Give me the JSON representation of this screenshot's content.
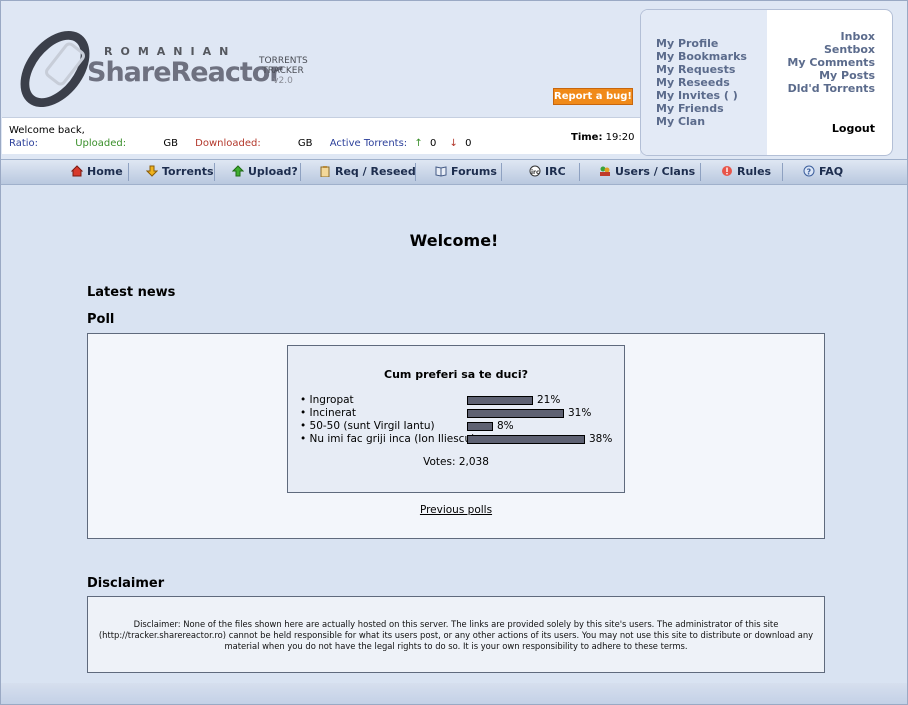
{
  "logo": {
    "top": "ROMANIAN",
    "name": "ShareReactor",
    "tracker_lines": [
      "TORRENTS",
      "TRACKER",
      "v2.0"
    ]
  },
  "report_bug": "Report a bug!",
  "user_menu": {
    "left": [
      "My Profile",
      "My Bookmarks",
      "My Requests",
      "My Reseeds",
      "My Invites (  )",
      "My Friends",
      "My Clan"
    ],
    "right": [
      "Inbox",
      "Sentbox",
      "My Comments",
      "My Posts",
      "Dld'd Torrents"
    ],
    "logout": "Logout"
  },
  "status": {
    "welcome": "Welcome back,",
    "ratio_label": "Ratio:",
    "uploaded_label": "Uploaded:",
    "uploaded_unit": "GB",
    "downloaded_label": "Downloaded:",
    "downloaded_unit": "GB",
    "active_label": "Active Torrents:",
    "seeding": "0",
    "leeching": "0",
    "time_label": "Time:",
    "time_value": "19:20"
  },
  "nav": [
    "Home",
    "Torrents",
    "Upload?",
    "Req / Reseed",
    "Forums",
    "IRC",
    "Users / Clans",
    "Rules",
    "FAQ"
  ],
  "main": {
    "welcome_title": "Welcome!",
    "latest_news": "Latest news",
    "poll_title": "Poll",
    "disclaimer_title": "Disclaimer"
  },
  "poll": {
    "question": "Cum preferi sa te duci?",
    "options": [
      {
        "label": "Ingropat",
        "percent": 21
      },
      {
        "label": "Incinerat",
        "percent": 31
      },
      {
        "label": "50-50 (sunt Virgil Iantu)",
        "percent": 8
      },
      {
        "label": "Nu imi fac griji inca (Ion Iliescu)",
        "percent": 38
      }
    ],
    "votes": "Votes: 2,038",
    "previous": "Previous polls"
  },
  "disclaimer": {
    "lines": [
      "Disclaimer: None of the files shown here are actually hosted on this server. The links are provided solely by this site's users. The administrator of this site",
      "(http://tracker.sharereactor.ro) cannot be held responsible for what its users post, or any other actions of its users. You may not use this site to distribute or download any",
      "material when you do not have the legal rights to do so. It is your own responsibility to adhere to these terms."
    ]
  }
}
